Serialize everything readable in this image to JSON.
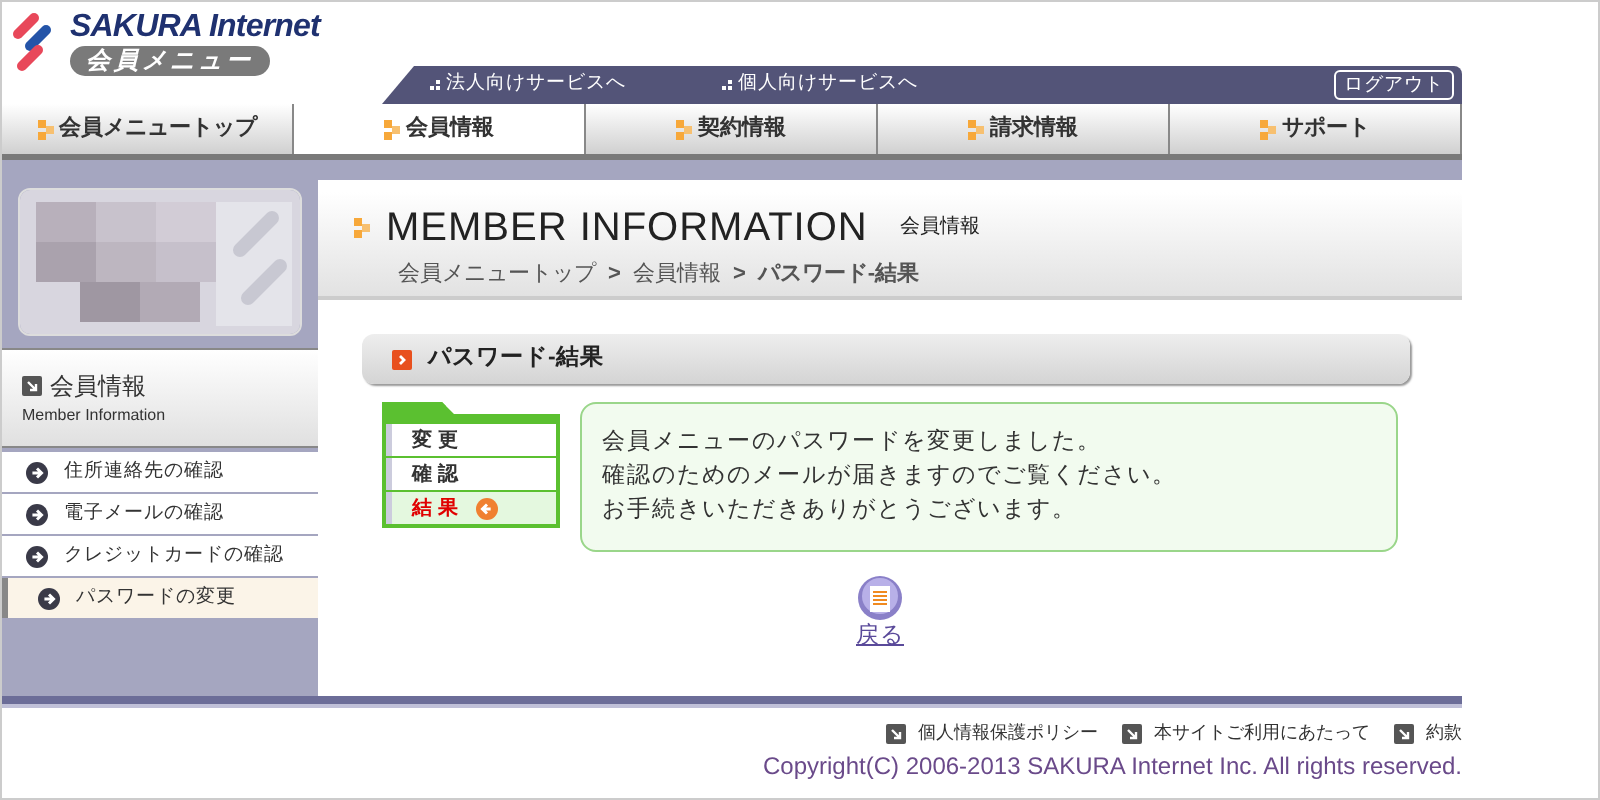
{
  "header": {
    "brand": "SAKURA Internet",
    "subtitle": "会員メニュー",
    "links": [
      "法人向けサービスへ",
      "個人向けサービスへ"
    ],
    "logout": "ログアウト"
  },
  "nav": [
    {
      "label": "会員メニュートップ",
      "selected": false
    },
    {
      "label": "会員情報",
      "selected": true
    },
    {
      "label": "契約情報",
      "selected": false
    },
    {
      "label": "請求情報",
      "selected": false
    },
    {
      "label": "サポート",
      "selected": false
    }
  ],
  "sidebar": {
    "section_title": "会員情報",
    "section_subtitle": "Member Information",
    "items": [
      {
        "label": "住所連絡先の確認",
        "selected": false
      },
      {
        "label": "電子メールの確認",
        "selected": false
      },
      {
        "label": "クレジットカードの確認",
        "selected": false
      },
      {
        "label": "パスワードの変更",
        "selected": true
      }
    ]
  },
  "page": {
    "title": "MEMBER INFORMATION",
    "title_sub": "会員情報",
    "breadcrumb": [
      "会員メニュートップ",
      "会員情報",
      "パスワード-結果"
    ],
    "breadcrumb_separator": ">"
  },
  "section": {
    "title": "パスワード-結果"
  },
  "steps": [
    {
      "label": "変更",
      "selected": false
    },
    {
      "label": "確認",
      "selected": false
    },
    {
      "label": "結果",
      "selected": true
    }
  ],
  "message": [
    "会員メニューのパスワードを変更しました。",
    "確認のためのメールが届きますのでご覧ください。",
    "お手続きいただきありがとうございます。"
  ],
  "back_link": "戻る",
  "footer": {
    "links": [
      "個人情報保護ポリシー",
      "本サイトご利用にあたって",
      "約款"
    ],
    "copyright": "Copyright(C) 2006-2013 SAKURA Internet Inc. All rights reserved."
  }
}
